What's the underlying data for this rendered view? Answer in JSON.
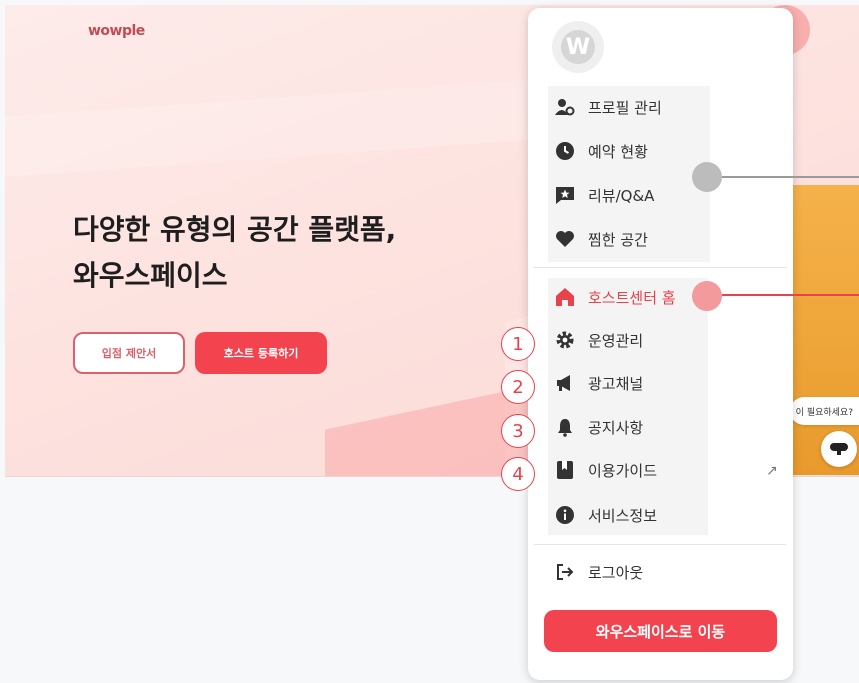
{
  "hero": {
    "logo": "wowple",
    "headline_line1": "다양한 유형의 공간 플랫폼,",
    "headline_line2": "와우스페이스",
    "btn_proposal": "입점 제안서",
    "btn_register": "호스트 등록하기",
    "help_text": "이 필요하세요?"
  },
  "menu": {
    "avatar_letter": "W",
    "group1": [
      {
        "label": "프로필 관리",
        "icon": "user-gear-icon"
      },
      {
        "label": "예약 현황",
        "icon": "clock-icon"
      },
      {
        "label": "리뷰/Q&A",
        "icon": "star-message-icon"
      },
      {
        "label": "찜한 공간",
        "icon": "heart-icon"
      }
    ],
    "group2": [
      {
        "label": "호스트센터 홈",
        "icon": "home-icon",
        "active": true
      },
      {
        "label": "운영관리",
        "icon": "gear-icon"
      },
      {
        "label": "광고채널",
        "icon": "megaphone-icon"
      },
      {
        "label": "공지사항",
        "icon": "bell-icon"
      },
      {
        "label": "이용가이드",
        "icon": "book-icon"
      },
      {
        "label": "서비스정보",
        "icon": "info-icon"
      }
    ],
    "external_mark": "↗",
    "logout": "로그아웃",
    "cta": "와우스페이스로 이동"
  },
  "annotations": {
    "numbers": [
      "1",
      "2",
      "3",
      "4"
    ]
  },
  "colors": {
    "accent": "#f2434f",
    "active_text": "#e8424d"
  }
}
